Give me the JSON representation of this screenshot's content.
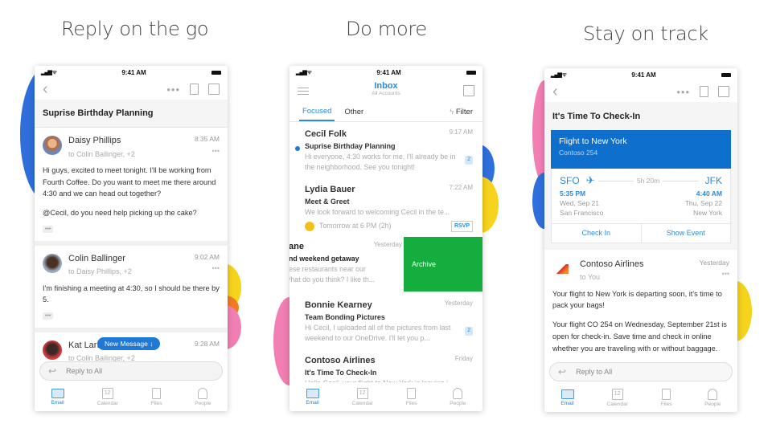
{
  "panels": [
    {
      "title": "Reply on the go"
    },
    {
      "title": "Do more"
    },
    {
      "title": "Stay on track"
    }
  ],
  "status_time": "9:41 AM",
  "colors": {
    "accent": "#2d8ad8",
    "archive": "#15ad3d",
    "card": "#0e6fcc",
    "blob_blue": "#2f6fdc",
    "blob_yellow": "#f6d31c",
    "blob_pink": "#f27fb3",
    "blob_orange": "#f47b22"
  },
  "phone1": {
    "subject": "Suprise Birthday Planning",
    "messages": [
      {
        "name": "Daisy Phillips",
        "to": "to Colin Ballinger, +2",
        "time": "8:35 AM",
        "body1": "Hi guys, excited to meet tonight. I'll be working from Fourth Coffee. Do you want to meet me there around 4:30 and we can head out together?",
        "body2": "@Cecil, do you need help picking up the cake?"
      },
      {
        "name": "Colin Ballinger",
        "to": "to Daisy Phillips, +2",
        "time": "9:02 AM",
        "body1": "I'm finishing a meeting at 4:30, so I should be there by 5."
      },
      {
        "name": "Kat Larsson",
        "to": "to Colin Ballinger, +2",
        "time": "9:28 AM"
      }
    ],
    "new_message": "New Message ↓",
    "reply_placeholder": "Reply to All"
  },
  "phone2": {
    "title": "Inbox",
    "subtitle": "All Accounts",
    "tabs": {
      "focused": "Focused",
      "other": "Other",
      "filter": "Filter"
    },
    "rows": [
      {
        "name": "Cecil Folk",
        "time": "9:17 AM",
        "subject": "Suprise Birthday Planning",
        "preview": "Hi everyone, 4:30 works for me, I'll already be in the neighborhood. See you tonight!",
        "badge": "2"
      },
      {
        "name": "Lydia Bauer",
        "time": "7:22 AM",
        "subject": "Meet & Greet",
        "preview": "We look forward to welcoming Cecil in the te...",
        "event": "Tomorrow at 6 PM (2h)",
        "rsvp": "RSVP"
      },
      {
        "name": "ane",
        "time": "Yesterday",
        "subject": "nd weekend getaway",
        "preview": "ese restaurants near our /hat do you think? I like th...",
        "archive": "Archive"
      },
      {
        "name": "Bonnie Kearney",
        "time": "Yesterday",
        "subject": "Team Bonding Pictures",
        "preview": "Hi Cecil, I uploaded all of the pictures from last weekend to our OneDrive. I'll let you p...",
        "badge": "2"
      },
      {
        "name": "Contoso Airlines",
        "time": "Friday",
        "subject": "It's Time To Check-In",
        "preview": "Hello Cecil, your flight to New York is leaving i..."
      }
    ]
  },
  "phone3": {
    "subject": "It's Time To Check-In",
    "card_title": "Flight to New York",
    "card_sub": "Contoso 254",
    "from_code": "SFO",
    "to_code": "JFK",
    "duration": "5h 20m",
    "dep_time": "5:35 PM",
    "arr_time": "4:40 AM",
    "dep_date": "Wed, Sep 21",
    "arr_date": "Thu, Sep 22",
    "dep_city": "San Francisco",
    "arr_city": "New York",
    "check_in": "Check In",
    "show_event": "Show Event",
    "sender": "Contoso Airlines",
    "to": "to You",
    "time": "Yesterday",
    "body1": "Your flight to New York is departing soon, it's time to pack your bags!",
    "body2": "Your flight CO 254 on Wednesday, September 21st is open for check-in. Save time and check in online whether you are traveling with or without baggage.",
    "reply_placeholder": "Reply to All"
  },
  "tabbar": [
    {
      "label": "Email",
      "icon": "mail-icon"
    },
    {
      "label": "Calendar",
      "icon": "calendar-icon",
      "glyph": "12"
    },
    {
      "label": "Files",
      "icon": "file-icon"
    },
    {
      "label": "People",
      "icon": "person-icon"
    }
  ]
}
